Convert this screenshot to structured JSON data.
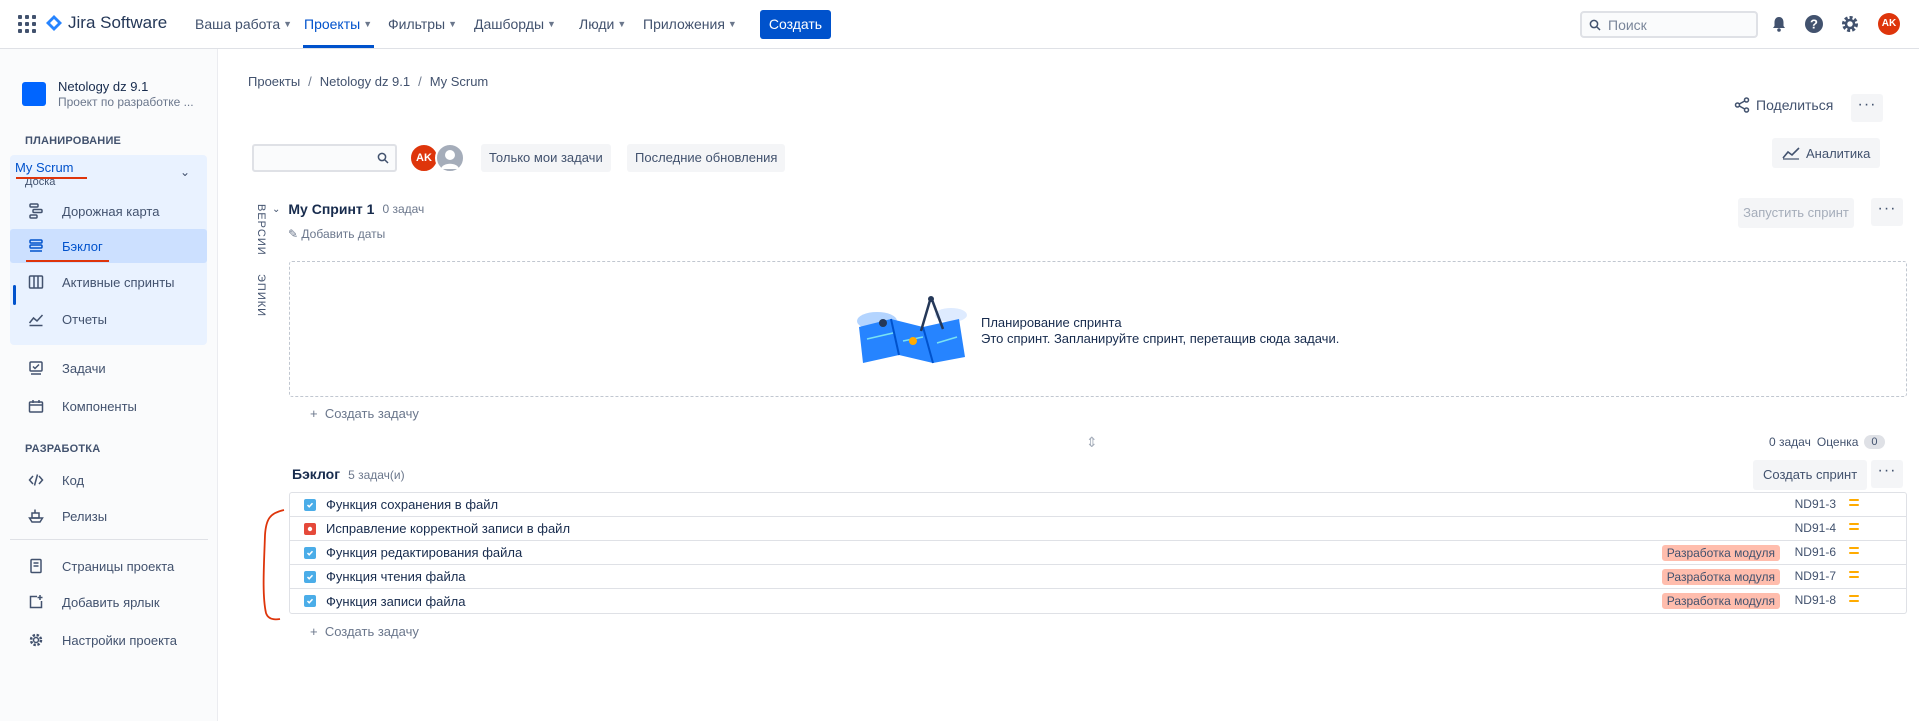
{
  "topnav": {
    "app_name": "Jira Software",
    "items": [
      {
        "label": "Ваша работа"
      },
      {
        "label": "Проекты"
      },
      {
        "label": "Фильтры"
      },
      {
        "label": "Дашборды"
      },
      {
        "label": "Люди"
      },
      {
        "label": "Приложения"
      }
    ],
    "create_label": "Создать",
    "search_placeholder": "Поиск",
    "avatar_initials": "AK"
  },
  "sidebar": {
    "project_name": "Netology dz 9.1",
    "project_desc": "Проект по разработке ...",
    "planning_title": "ПЛАНИРОВАНИЕ",
    "board_name": "My Scrum",
    "board_sub": "Доска",
    "planning_items": [
      {
        "label": "Дорожная карта"
      },
      {
        "label": "Бэклог"
      },
      {
        "label": "Активные спринты"
      },
      {
        "label": "Отчеты"
      }
    ],
    "other_items": [
      {
        "label": "Задачи"
      },
      {
        "label": "Компоненты"
      }
    ],
    "dev_title": "РАЗРАБОТКА",
    "dev_items": [
      {
        "label": "Код"
      },
      {
        "label": "Релизы"
      }
    ],
    "bottom_items": [
      {
        "label": "Страницы проекта"
      },
      {
        "label": "Добавить ярлык"
      },
      {
        "label": "Настройки проекта"
      }
    ]
  },
  "breadcrumbs": [
    "Проекты",
    "Netology dz 9.1",
    "My Scrum"
  ],
  "share_label": "Поделиться",
  "filters": {
    "avatar_initials": "AK",
    "only_my": "Только мои задачи",
    "recent": "Последние обновления",
    "analytics": "Аналитика"
  },
  "side_tabs": {
    "versions": "ВЕРСИИ",
    "epics": "ЭПИКИ"
  },
  "sprint": {
    "name": "My Спринт 1",
    "count": "0 задач",
    "add_dates": "Добавить даты",
    "start": "Запустить спринт",
    "empty_title": "Планирование спринта",
    "empty_desc": "Это спринт. Запланируйте спринт, перетащив сюда задачи.",
    "create_issue": "Создать задачу",
    "summary_count": "0 задач",
    "estimate_label": "Оценка",
    "estimate_value": "0"
  },
  "backlog": {
    "title": "Бэклог",
    "count": "5 задач(и)",
    "create_sprint": "Создать спринт",
    "create_issue": "Создать задачу",
    "issues": [
      {
        "type": "task",
        "summary": "Функция сохранения в файл",
        "epic": "",
        "key": "ND91-3"
      },
      {
        "type": "bug",
        "summary": "Исправление корректной записи в файл",
        "epic": "",
        "key": "ND91-4"
      },
      {
        "type": "task",
        "summary": "Функция редактирования файла",
        "epic": "Разработка модуля",
        "key": "ND91-6"
      },
      {
        "type": "task",
        "summary": "Функция чтения файла",
        "epic": "Разработка модуля",
        "key": "ND91-7"
      },
      {
        "type": "task",
        "summary": "Функция записи файла",
        "epic": "Разработка модуля",
        "key": "ND91-8"
      }
    ]
  },
  "colors": {
    "brand": "#0052cc",
    "epic_bg": "#ffbdad",
    "priority": "#ffab00",
    "annotation": "#de350b"
  }
}
